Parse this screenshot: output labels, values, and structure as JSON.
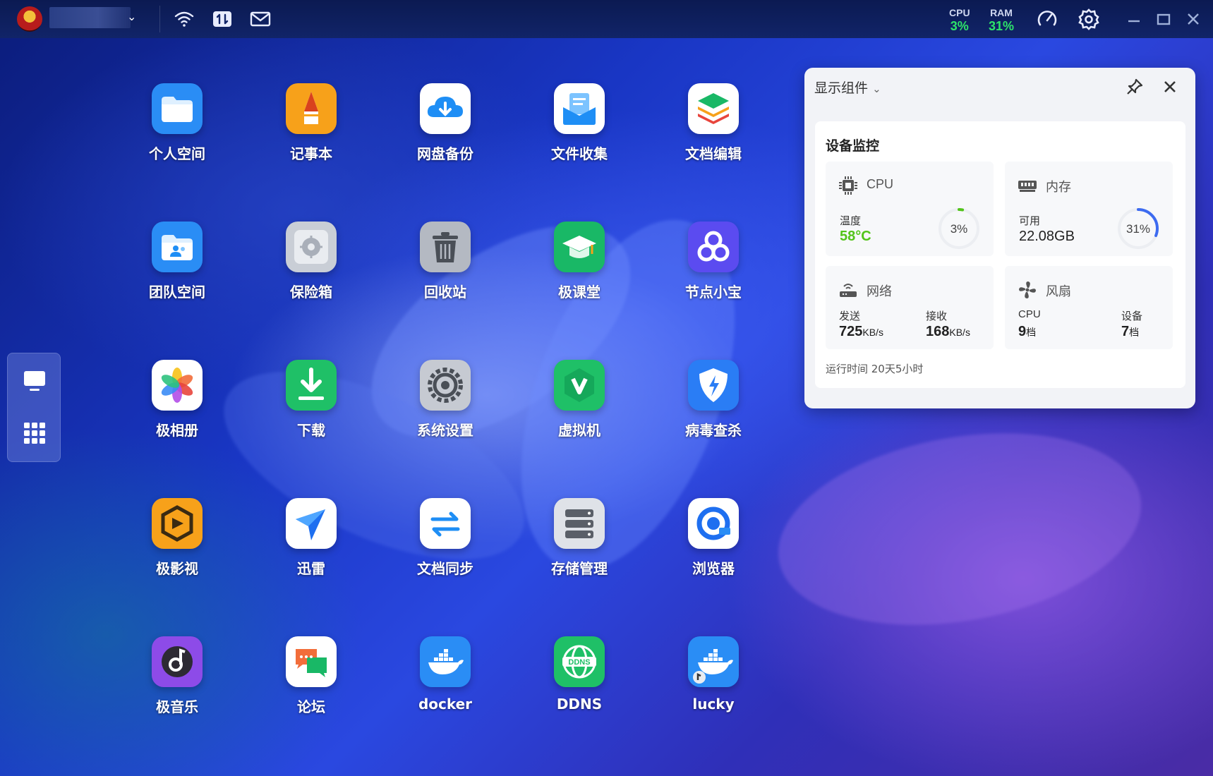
{
  "topbar": {
    "cpu_label": "CPU",
    "cpu_value": "3%",
    "ram_label": "RAM",
    "ram_value": "31%",
    "user_caret": "⌄",
    "icons": [
      "wifi-icon",
      "transfer-icon",
      "mail-icon",
      "dashboard-icon",
      "settings-icon"
    ]
  },
  "dock": {
    "items": [
      "desktop-icon",
      "apps-grid-icon"
    ]
  },
  "apps": [
    {
      "label": "个人空间",
      "icon": "folder-icon",
      "bg": "#2a8df5"
    },
    {
      "label": "记事本",
      "icon": "notepad-icon",
      "bg": "#f7a11a"
    },
    {
      "label": "网盘备份",
      "icon": "cloud-backup-icon",
      "bg": "#ffffff"
    },
    {
      "label": "文件收集",
      "icon": "file-collect-icon",
      "bg": "#ffffff"
    },
    {
      "label": "文档编辑",
      "icon": "doc-edit-icon",
      "bg": "#ffffff"
    },
    {
      "label": "团队空间",
      "icon": "team-folder-icon",
      "bg": "#2a8df5"
    },
    {
      "label": "保险箱",
      "icon": "safe-icon",
      "bg": "#c9ced6"
    },
    {
      "label": "回收站",
      "icon": "trash-icon",
      "bg": "#b4b9c2"
    },
    {
      "label": "极课堂",
      "icon": "classroom-icon",
      "bg": "#19b866"
    },
    {
      "label": "节点小宝",
      "icon": "node-icon",
      "bg": "#5b4bf0"
    },
    {
      "label": "极相册",
      "icon": "photos-icon",
      "bg": "#ffffff"
    },
    {
      "label": "下载",
      "icon": "download-icon",
      "bg": "#1fc067"
    },
    {
      "label": "系统设置",
      "icon": "system-settings-icon",
      "bg": "#c6cad2"
    },
    {
      "label": "虚拟机",
      "icon": "vm-icon",
      "bg": "#1fc067"
    },
    {
      "label": "病毒查杀",
      "icon": "antivirus-icon",
      "bg": "#2a7df5"
    },
    {
      "label": "极影视",
      "icon": "video-icon",
      "bg": "#f7a11a"
    },
    {
      "label": "迅雷",
      "icon": "thunder-icon",
      "bg": "#ffffff"
    },
    {
      "label": "文档同步",
      "icon": "sync-icon",
      "bg": "#ffffff"
    },
    {
      "label": "存储管理",
      "icon": "storage-icon",
      "bg": "#dfe2e8"
    },
    {
      "label": "浏览器",
      "icon": "browser-icon",
      "bg": "#ffffff"
    },
    {
      "label": "极音乐",
      "icon": "music-icon",
      "bg": "#8d4be8"
    },
    {
      "label": "论坛",
      "icon": "forum-icon",
      "bg": "#ffffff"
    },
    {
      "label": "docker",
      "icon": "docker-icon",
      "bg": "#2a8df5"
    },
    {
      "label": "DDNS",
      "icon": "ddns-icon",
      "bg": "#1fc067"
    },
    {
      "label": "lucky",
      "icon": "lucky-icon",
      "bg": "#2a8df5"
    }
  ],
  "widget": {
    "header": "显示组件",
    "header_caret": "⌄",
    "card_title": "设备监控",
    "cpu": {
      "name": "CPU",
      "temp_label": "温度",
      "temp_value": "58°C",
      "usage_text": "3%",
      "usage": 0.03,
      "ring_color": "#52c41a"
    },
    "memory": {
      "name": "内存",
      "avail_label": "可用",
      "avail_value": "22.08GB",
      "usage_text": "31%",
      "usage": 0.31,
      "ring_color": "#3d6bf0"
    },
    "network": {
      "name": "网络",
      "send_label": "发送",
      "send_value": "725",
      "send_unit": "KB/s",
      "recv_label": "接收",
      "recv_value": "168",
      "recv_unit": "KB/s"
    },
    "fan": {
      "name": "风扇",
      "cpu_label": "CPU",
      "cpu_value": "9",
      "cpu_unit": "档",
      "device_label": "设备",
      "device_value": "7",
      "device_unit": "档"
    },
    "uptime": "运行时间 20天5小时"
  }
}
